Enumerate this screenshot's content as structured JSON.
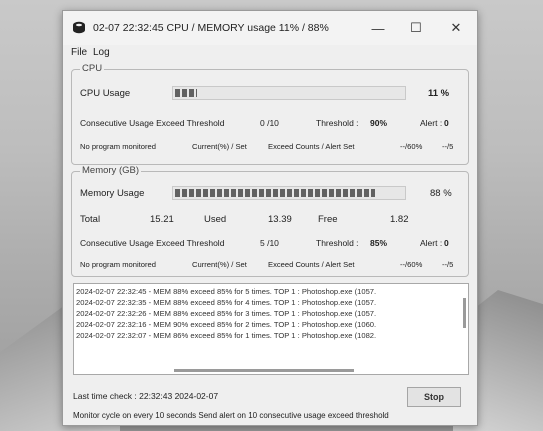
{
  "window": {
    "title": "02-07 22:32:45 CPU / MEMORY usage 11% / 88%",
    "controls": {
      "minimize": "—",
      "maximize": "☐",
      "close": "✕"
    }
  },
  "menu": {
    "file": "File",
    "log": "Log"
  },
  "cpu": {
    "group_label": "CPU",
    "usage_label": "CPU Usage",
    "usage_value": "11 %",
    "usage_fraction": 0.11,
    "consec_label": "Consecutive Usage Exceed Threshold",
    "consec_value": "0 /10",
    "threshold_label": "Threshold :",
    "threshold_value": "90%",
    "alert_label": "Alert :",
    "alert_value": "0",
    "monitor_label": "No program monitored",
    "current_label": "Current(%) / Set",
    "exceed_label": "Exceed Counts / Alert Set",
    "current_value": "--/60%",
    "exceed_value": "--/5"
  },
  "memory": {
    "group_label": "Memory (GB)",
    "usage_label": "Memory Usage",
    "usage_value": "88 %",
    "usage_fraction": 0.88,
    "total_label": "Total",
    "total_value": "15.21",
    "used_label": "Used",
    "used_value": "13.39",
    "free_label": "Free",
    "free_value": "1.82",
    "consec_label": "Consecutive Usage Exceed Threshold",
    "consec_value": "5 /10",
    "threshold_label": "Threshold :",
    "threshold_value": "85%",
    "alert_label": "Alert :",
    "alert_value": "0",
    "monitor_label": "No program monitored",
    "current_label": "Current(%) / Set",
    "exceed_label": "Exceed Counts / Alert Set",
    "current_value": "--/60%",
    "exceed_value": "--/5"
  },
  "log_lines": [
    "2024-02-07 22:32:45 - MEM 88% exceed 85% for 5 times. TOP 1 : Photoshop.exe (1057.",
    "2024-02-07 22:32:35 - MEM 88% exceed 85% for 4 times. TOP 1 : Photoshop.exe (1057.",
    "2024-02-07 22:32:26 - MEM 88% exceed 85% for 3 times. TOP 1 : Photoshop.exe (1057.",
    "2024-02-07 22:32:16 - MEM 90% exceed 85% for 2 times. TOP 1 : Photoshop.exe (1060.",
    "2024-02-07 22:32:07 - MEM 86% exceed 85% for 1 times. TOP 1 : Photoshop.exe (1082."
  ],
  "footer": {
    "last_check": "Last time check :  22:32:43 2024-02-07",
    "stop_label": "Stop",
    "monitor_cycle": "Monitor cycle on every 10 seconds   Send alert on 10 consecutive usage exceed threshold"
  }
}
